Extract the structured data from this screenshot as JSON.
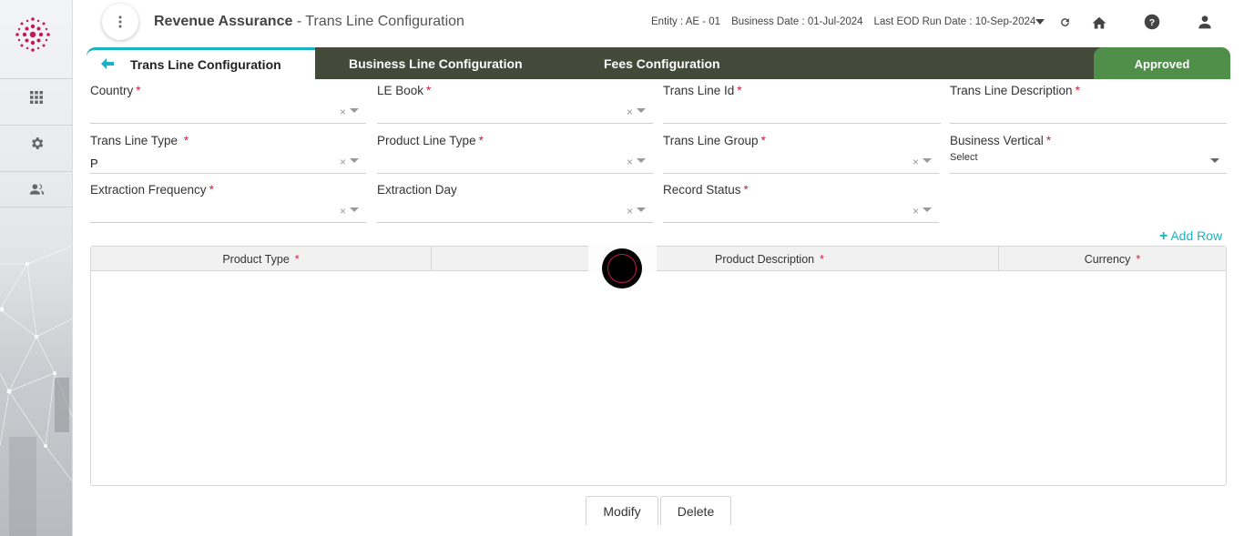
{
  "header": {
    "app_name": "Revenue Assurance",
    "page_name": " - Trans Line Configuration",
    "entity": "Entity : AE - 01",
    "business_date": "Business Date : 01-Jul-2024",
    "last_eod": "Last EOD Run Date : 10-Sep-2024"
  },
  "tabs": {
    "active": "Trans Line Configuration",
    "business_line": "Business Line Configuration",
    "fees": "Fees Configuration",
    "status": "Approved"
  },
  "form": {
    "country": {
      "label": "Country",
      "value": ""
    },
    "le_book": {
      "label": "LE Book",
      "value": ""
    },
    "trans_line_id": {
      "label": "Trans Line Id",
      "value": ""
    },
    "trans_line_description": {
      "label": "Trans Line Description",
      "value": ""
    },
    "trans_line_type": {
      "label": "Trans Line Type",
      "value": "P"
    },
    "product_line_type": {
      "label": "Product Line Type",
      "value": ""
    },
    "trans_line_group": {
      "label": "Trans Line Group",
      "value": ""
    },
    "business_vertical": {
      "label": "Business Vertical",
      "placeholder": "Select"
    },
    "extraction_frequency": {
      "label": "Extraction Frequency",
      "value": ""
    },
    "extraction_day": {
      "label": "Extraction Day",
      "value": ""
    },
    "record_status": {
      "label": "Record Status",
      "value": ""
    },
    "required_mark": "*",
    "clear_glyph": "×"
  },
  "grid": {
    "add_row": "Add Row",
    "columns": [
      "Product Type",
      "Product Description",
      "Currency"
    ]
  },
  "actions": {
    "modify": "Modify",
    "delete": "Delete"
  },
  "colors": {
    "accent": "#1bb3c4",
    "tab_bar": "#444a39",
    "approved": "#4f8f49",
    "required": "#d02040",
    "logo": "#c2185b"
  }
}
